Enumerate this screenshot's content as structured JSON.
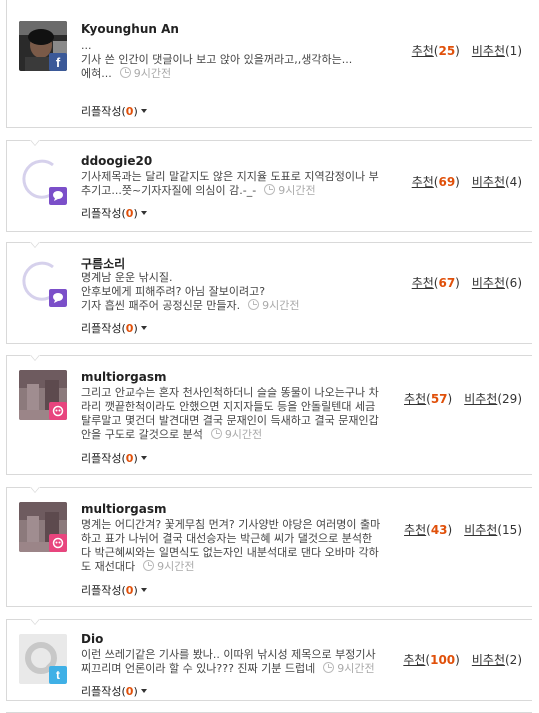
{
  "labels": {
    "recommend": "추천",
    "not_recommend": "비추천",
    "reply_write": "리플작성",
    "open": "(",
    "close": ")"
  },
  "colors": {
    "facebook": "#3b5998",
    "yozm": "#7b4fc9",
    "mypeople": "#e8457e",
    "twitter": "#3fb0e6",
    "count_orange": "#e0500a"
  },
  "comments": [
    {
      "user": "Kyounghun An",
      "lines": [
        "...",
        "기사 쓴 인간이 댓글이나 보고 앉아 있을꺼라고,,생각하는...",
        "에혀..."
      ],
      "time": "9시간전",
      "replies": "0",
      "up": "25",
      "down": "1",
      "badge": "facebook-icon"
    },
    {
      "user": "ddoogie20",
      "lines": [
        "기사제목과는 달리 말같지도 않은 지지율 도표로 지역감정이나 부",
        "추기고...쯧~기자자질에 의심이 감.-_-"
      ],
      "time": "9시간전",
      "replies": "0",
      "up": "69",
      "down": "4",
      "badge": "yozm-icon"
    },
    {
      "user": "구름소리",
      "lines": [
        "명계남 운운 낚시질.",
        "안후보에게 피해주려? 아님 잘보이려고?",
        "기자 흡씬 패주어 공정신문 만들자."
      ],
      "time": "9시간전",
      "replies": "0",
      "up": "67",
      "down": "6",
      "badge": "yozm-icon"
    },
    {
      "user": "multiorgasm",
      "lines": [
        "그리고 안교수는 혼자 천사인척하더니 슬슬 똥물이 나오는구나 차",
        "라리 깻끝한척이라도 안했으면 지지자들도 등을 안돌릴텐대 세금",
        "탈루말고 몇건더 발견대면 결국 문재인이 득새하고 결국 문재인갑",
        "안을 구도로 갈것으로 분석"
      ],
      "time": "9시간전",
      "replies": "0",
      "up": "57",
      "down": "29",
      "badge": "mypeople-icon"
    },
    {
      "user": "multiorgasm",
      "lines": [
        "명계는 어디간겨? 꽃게무침 먼겨? 기사양반 야당은 여러명이 출마",
        "하고 표가 나뉘어 결국 대선승자는 박근혜 씨가 댈것으로 분석한",
        "다 박근혜씨와는 일면식도 없는자인 내분석대로 댄다 오바마 각하",
        "도 재선대다"
      ],
      "time": "9시간전",
      "replies": "0",
      "up": "43",
      "down": "15",
      "badge": "mypeople-icon"
    },
    {
      "user": "Dio",
      "lines": [
        "이런 쓰레기같은 기사를 봤나.. 이따위 낚시성 제목으로 부정기사",
        "찌끄리며 언론이라 할 수 있나??? 진짜 기분 드럽네"
      ],
      "time": "9시간전",
      "replies": "0",
      "up": "100",
      "down": "2",
      "badge": "twitter-icon"
    }
  ]
}
